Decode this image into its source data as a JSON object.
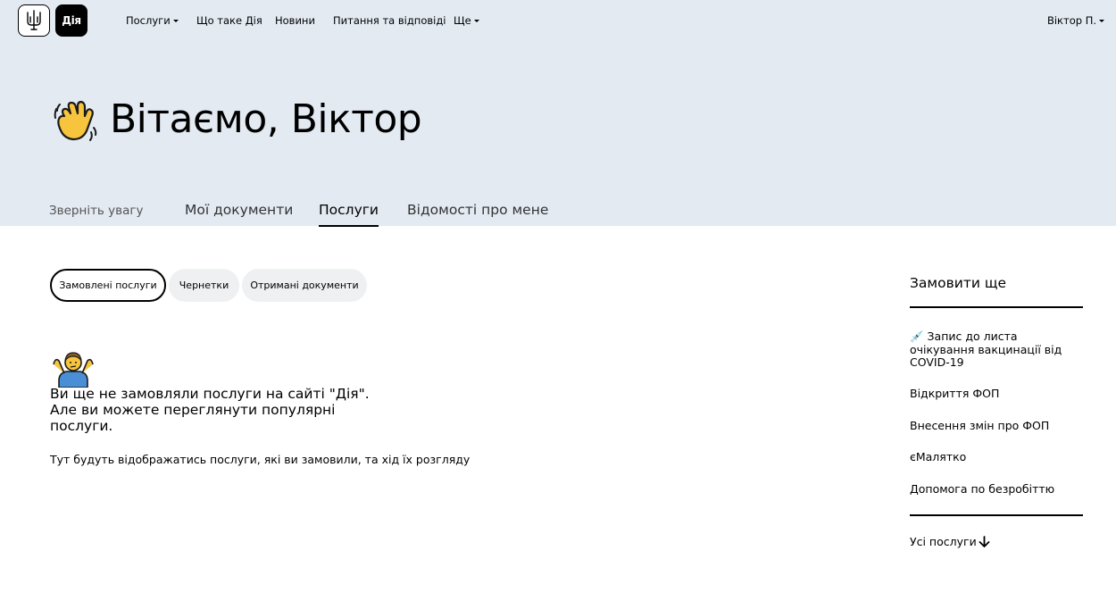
{
  "header": {
    "logo_diia_text": "Дія",
    "nav": [
      {
        "label": "Послуги",
        "has_dropdown": true
      },
      {
        "label": "Що таке Дія",
        "has_dropdown": false
      },
      {
        "label": "Новини",
        "has_dropdown": false
      },
      {
        "label": "Питання та відповіді",
        "has_dropdown": false
      },
      {
        "label": "Ще",
        "has_dropdown": true
      }
    ],
    "user_label": "Віктор П.",
    "user_has_dropdown": true
  },
  "hero": {
    "emoji_icon": "waving-hand-icon",
    "greeting": "Вітаємо, Віктор"
  },
  "tabs": [
    {
      "label": "Зверніть увагу",
      "active": false
    },
    {
      "label": "Мої документи",
      "active": false
    },
    {
      "label": "Послуги",
      "active": true
    },
    {
      "label": "Відомості про мене",
      "active": false
    }
  ],
  "filters": [
    {
      "label": "Замовлені послуги",
      "active": true
    },
    {
      "label": "Чернетки",
      "active": false
    },
    {
      "label": "Отримані документи",
      "active": false
    }
  ],
  "empty_state": {
    "emoji_icon": "shrug-icon",
    "title": "Ви ще не замовляли послуги на сайті \"Дія\". Але ви можете переглянути популярні послуги.",
    "subtitle": "Тут будуть відображатись послуги, які ви замовили, та хід їх розгляду"
  },
  "sidebar": {
    "title": "Замовити ще",
    "links": [
      {
        "label": "💉 Запис до листа очікування вакцинації від COVID-19"
      },
      {
        "label": "Відкриття ФОП"
      },
      {
        "label": "Внесення змін про ФОП"
      },
      {
        "label": "єМалятко"
      },
      {
        "label": "Допомога по безробіттю"
      }
    ],
    "all_services": "Усі послуги"
  },
  "colors": {
    "header_bg": "#e3eaf2",
    "pill_bg": "#eef0f2",
    "text": "#000000"
  }
}
